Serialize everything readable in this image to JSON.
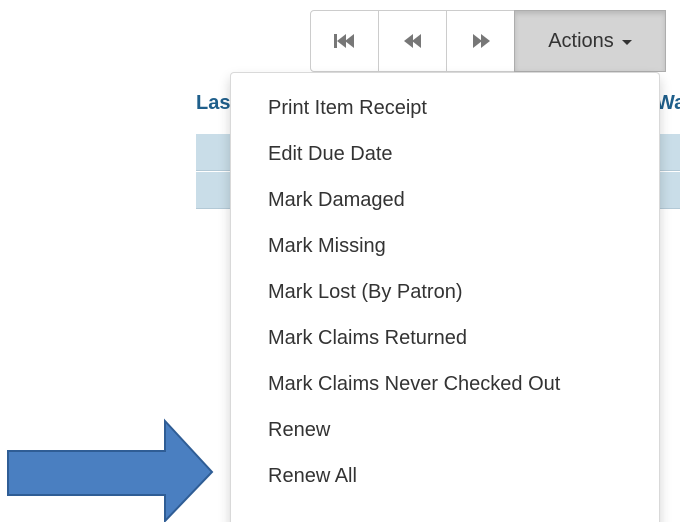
{
  "toolbar": {
    "first_icon": "first-page-icon",
    "prev_icon": "previous-page-icon",
    "next_icon": "next-page-icon",
    "actions_label": "Actions"
  },
  "table": {
    "header_left": "Last",
    "header_right": "Wa"
  },
  "menu": {
    "items": [
      {
        "label": "Print Item Receipt"
      },
      {
        "label": "Edit Due Date"
      },
      {
        "label": "Mark Damaged"
      },
      {
        "label": "Mark Missing"
      },
      {
        "label": "Mark Lost (By Patron)"
      },
      {
        "label": "Mark Claims Returned"
      },
      {
        "label": "Mark Claims Never Checked Out"
      },
      {
        "label": "Renew"
      },
      {
        "label": "Renew All"
      }
    ]
  },
  "annotation": {
    "arrow_color": "#4a7fc1",
    "arrow_border": "#2f5d95",
    "arrow_icon": "right-arrow-icon"
  }
}
